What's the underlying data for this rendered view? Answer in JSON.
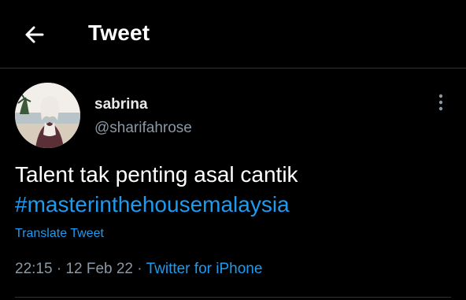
{
  "header": {
    "title": "Tweet",
    "back_icon": "arrow-left-icon"
  },
  "tweet": {
    "author": {
      "display_name": "sabrina",
      "handle": "@sharifahrose"
    },
    "more_icon": "vertical-ellipsis-icon",
    "text_line": "Talent tak penting asal cantik",
    "hashtag": "#masterinthehousemalaysia",
    "translate_label": "Translate Tweet",
    "time": "22:15",
    "separator": "·",
    "date": "12 Feb 22",
    "source": "Twitter for iPhone"
  },
  "colors": {
    "background": "#000000",
    "text": "#e7e9ea",
    "secondary": "#8b98a5",
    "accent": "#1d9bf0",
    "divider": "#2f3336"
  }
}
